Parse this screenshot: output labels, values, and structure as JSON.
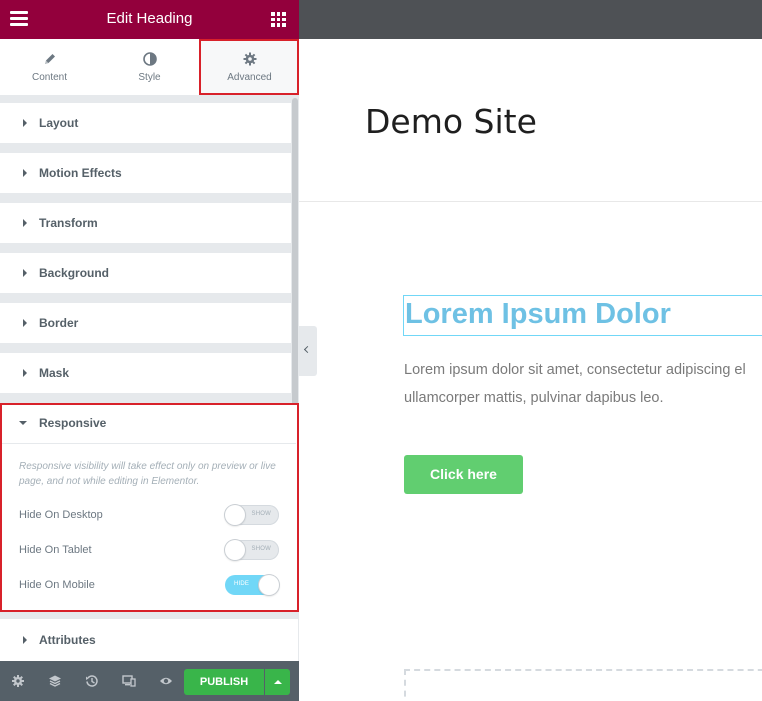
{
  "panel": {
    "title": "Edit Heading",
    "tabs": [
      {
        "label": "Content",
        "icon": "pencil-icon"
      },
      {
        "label": "Style",
        "icon": "half-circle-icon"
      },
      {
        "label": "Advanced",
        "icon": "gear-icon"
      }
    ],
    "active_tab": "Advanced",
    "sections": [
      {
        "label": "Layout"
      },
      {
        "label": "Motion Effects"
      },
      {
        "label": "Transform"
      },
      {
        "label": "Background"
      },
      {
        "label": "Border"
      },
      {
        "label": "Mask"
      }
    ],
    "responsive": {
      "label": "Responsive",
      "note": "Responsive visibility will take effect only on preview or live page, and not while editing in Elementor.",
      "controls": [
        {
          "label": "Hide On Desktop",
          "state": "SHOW",
          "on": false
        },
        {
          "label": "Hide On Tablet",
          "state": "SHOW",
          "on": false
        },
        {
          "label": "Hide On Mobile",
          "state": "HIDE",
          "on": true
        }
      ]
    },
    "attributes_label": "Attributes"
  },
  "footer": {
    "icons": [
      "settings-icon",
      "layers-icon",
      "history-icon",
      "responsive-mode-icon",
      "preview-eye-icon"
    ],
    "publish_label": "PUBLISH"
  },
  "preview": {
    "site_title": "Demo Site",
    "heading": "Lorem Ipsum Dolor",
    "paragraph_line1": "Lorem ipsum dolor sit amet, consectetur adipiscing el",
    "paragraph_line2": "ullamcorper mattis, pulvinar dapibus leo.",
    "button_label": "Click here"
  },
  "colors": {
    "panel_header": "#93003c",
    "highlight": "#d8212a",
    "toggle_on": "#71d7f7",
    "publish": "#39b54a",
    "heading": "#6ec1e4",
    "cta": "#61ce70"
  }
}
